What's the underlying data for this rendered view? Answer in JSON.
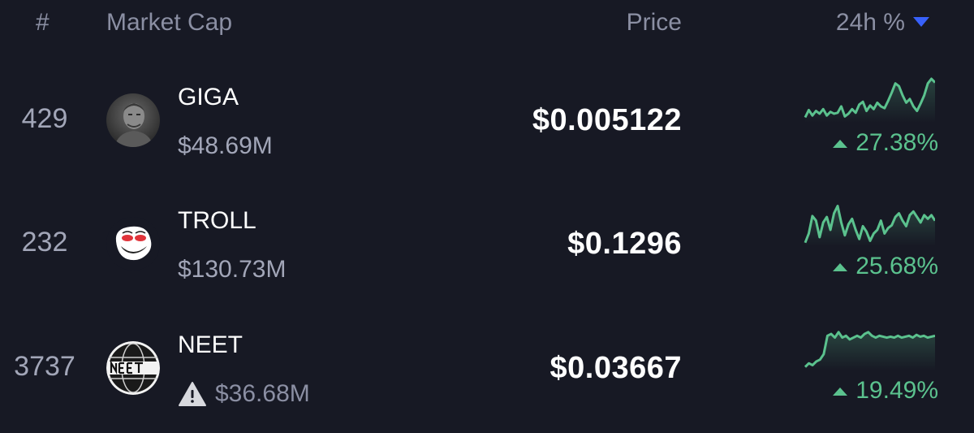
{
  "header": {
    "rank_label": "#",
    "market_cap_label": "Market Cap",
    "price_label": "Price",
    "change_label": "24h %"
  },
  "colors": {
    "background": "#171924",
    "muted_text": "#8b8fa3",
    "positive": "#5bc28e",
    "sort_accent": "#3861fb"
  },
  "rows": [
    {
      "rank": "429",
      "name": "GIGA",
      "market_cap": "$48.69M",
      "price": "$0.005122",
      "change": "27.38%",
      "logo_icon": "giga-face-avatar",
      "warning": false,
      "sparkline": [
        42,
        34,
        40,
        35,
        38,
        33,
        40,
        36,
        38,
        37,
        30,
        41,
        38,
        33,
        37,
        28,
        25,
        35,
        29,
        33,
        26,
        30,
        32,
        24,
        15,
        5,
        8,
        18,
        26,
        22,
        30,
        35,
        27,
        18,
        5,
        0,
        4
      ]
    },
    {
      "rank": "232",
      "name": "TROLL",
      "market_cap": "$130.73M",
      "price": "$0.1296",
      "change": "25.68%",
      "logo_icon": "trollface-icon",
      "warning": false,
      "sparkline": [
        44,
        34,
        15,
        20,
        38,
        22,
        16,
        30,
        12,
        4,
        22,
        36,
        24,
        18,
        30,
        40,
        26,
        32,
        42,
        34,
        30,
        20,
        34,
        28,
        25,
        16,
        12,
        20,
        26,
        14,
        10,
        16,
        22,
        14,
        18,
        14,
        20
      ]
    },
    {
      "rank": "3737",
      "name": "NEET",
      "market_cap": "$36.68M",
      "price": "$0.03667",
      "change": "19.49%",
      "logo_icon": "neet-globe-logo",
      "warning": true,
      "sparkline": [
        44,
        40,
        42,
        38,
        36,
        30,
        10,
        8,
        12,
        6,
        12,
        10,
        14,
        12,
        10,
        12,
        8,
        6,
        10,
        12,
        10,
        11,
        12,
        11,
        12,
        10,
        12,
        11,
        10,
        12,
        9,
        11,
        10,
        12,
        11,
        10
      ]
    }
  ]
}
